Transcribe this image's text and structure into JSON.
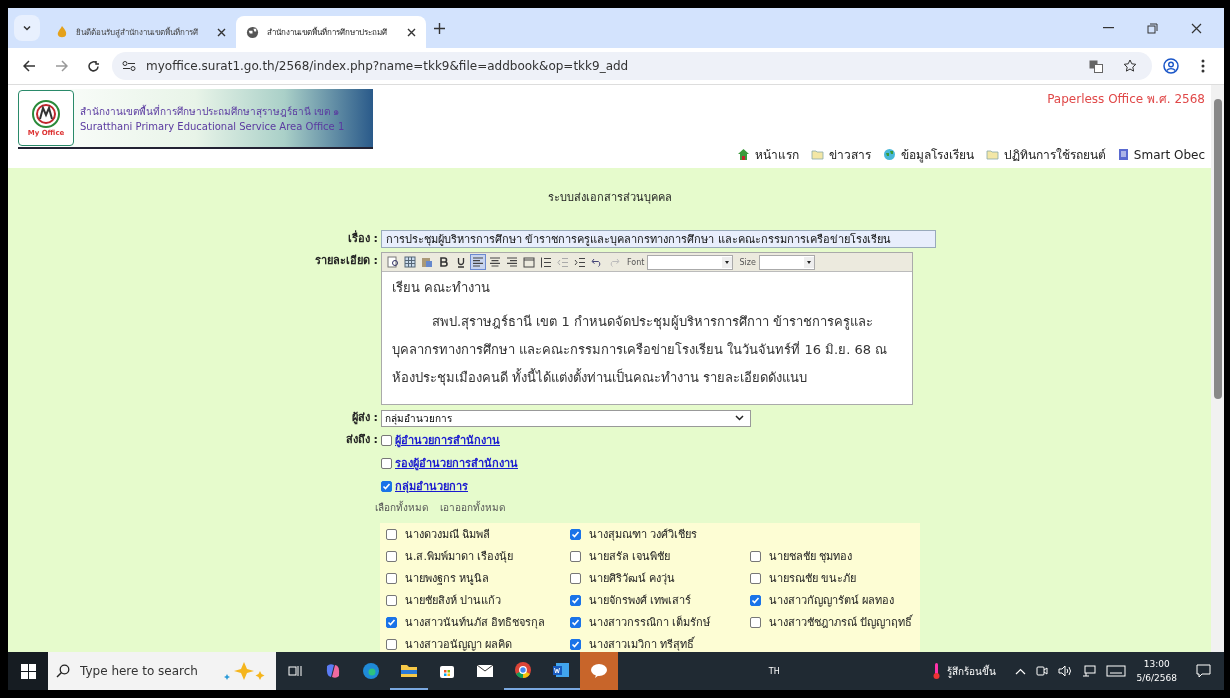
{
  "browser": {
    "tabs": [
      {
        "title": "ยินดีต้อนรับสู่สำนักงานเขตพื้นที่การศึ",
        "selected": false
      },
      {
        "title": "สำนักงานเขตพื้นที่การศึกษาประถมศึ",
        "selected": true
      }
    ],
    "url": "myoffice.surat1.go.th/2568/index.php?name=tkk9&file=addbook&op=tkk9_add"
  },
  "header": {
    "org_th": "สำนักงานเขตพื้นที่การศึกษาประถมศึกษาสุราษฎร์ธานี เขต ๑",
    "org_en": "Suratthani Primary Educational Service Area Office 1",
    "logo_text": "My Office",
    "tagline": "Paperless Office พ.ศ. 2568",
    "nav": [
      {
        "label": "หน้าแรก",
        "kind": "home"
      },
      {
        "label": "ข่าวสาร",
        "kind": "folder"
      },
      {
        "label": "ข้อมูลโรงเรียน",
        "kind": "globe"
      },
      {
        "label": "ปฏิทินการใช้รถยนต์",
        "kind": "folder"
      },
      {
        "label": "Smart Obec",
        "kind": "doc"
      }
    ]
  },
  "form": {
    "title": "ระบบส่งเอกสารส่วนบุคคล",
    "subject_label": "เรื่อง :",
    "subject_value": "การประชุมผู้บริหารการศึกษา ข้าราชการครูและบุคลากรทางการศึกษา และคณะกรรมการเครือข่ายโรงเรียน",
    "details_label": "รายละเอียด :",
    "editor": {
      "align_buttons": [
        {
          "selected": true
        },
        {
          "selected": false
        },
        {
          "selected": false
        }
      ],
      "font_label": "Font",
      "size_label": "Size",
      "greeting": "เรียน  คณะทำงาน",
      "body": "สพป.สุราษฎร์ธานี เขต 1 กำหนดจัดประชุมผู้บริหารการศึกาา ข้าราชการครูและบุคลากรทางการศึกษา และคณะกรรมการเครือข่ายโรงเรียน ในวันจันทร์ที่ 16 มิ.ย. 68 ณ ห้องประชุมเมืองคนดี ทั้งนี้ได้แต่งตั้งท่านเป็นคณะทำงาน รายละเอียดดังแนบ"
    },
    "sender_label": "ผู้ส่ง :",
    "sender_value": "กลุ่มอำนวยการ",
    "recipients_label": "ส่งถึง :",
    "groups": [
      {
        "label": "ผู้อำนวยการสำนักงาน",
        "checked": false
      },
      {
        "label": "รองผู้อำนวยการสำนักงาน",
        "checked": false
      },
      {
        "label": "กลุ่มอำนวยการ",
        "checked": true
      }
    ],
    "select_all": "เลือกทั้งหมด",
    "deselect_all": "เอาออกทั้งหมด",
    "people": [
      [
        {
          "name": "นางดวงมณี ฉิมพลี",
          "checked": false
        },
        {
          "name": "นางสุมณฑา วงศ์วิเชียร",
          "checked": true
        }
      ],
      [
        {
          "name": "น.ส.พิมพ์มาดา เรืองนุ้ย",
          "checked": false
        },
        {
          "name": "นายสรัล เจนพิชัย",
          "checked": false
        },
        {
          "name": "นายชลชัย ชุมทอง",
          "checked": false
        }
      ],
      [
        {
          "name": "นายพงฐกร หนูนิล",
          "checked": false
        },
        {
          "name": "นายศิริวัฒน์ คงวุ่น",
          "checked": false
        },
        {
          "name": "นายรณชัย ขนะภัย",
          "checked": false
        }
      ],
      [
        {
          "name": "นายชัยสิงห์ ปานแก้ว",
          "checked": false
        },
        {
          "name": "นายจักรพงศ์ เทพเสาร์",
          "checked": true
        },
        {
          "name": "นางสาวกัญญารัตน์ ผลทอง",
          "checked": true
        }
      ],
      [
        {
          "name": "นางสาวนันท์นภัส อิทธิชจรกุล",
          "checked": true
        },
        {
          "name": "นางสาวกรรณิกา เต็มรักษ์",
          "checked": true
        },
        {
          "name": "นางสาวชัชฎาภรณ์ ปัญญาฤทธิ์",
          "checked": false
        }
      ],
      [
        {
          "name": "นางสาวอนัญญา ผลคิด",
          "checked": false
        },
        {
          "name": "นางสาวเมวิกา ทรีสุทธิ์",
          "checked": true
        }
      ]
    ]
  },
  "taskbar": {
    "search_placeholder": "Type here to search",
    "language": "TH",
    "weather": "รู้สึกร้อนขึ้น",
    "time": "13:00",
    "date": "5/6/2568"
  }
}
